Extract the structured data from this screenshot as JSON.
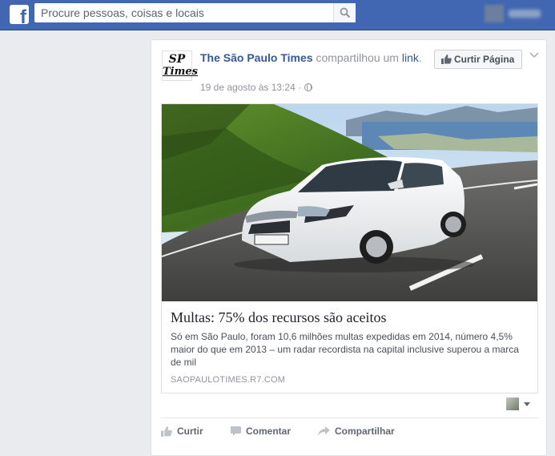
{
  "topbar": {
    "logo_letter": "f",
    "search_placeholder": "Procure pessoas, coisas e locais"
  },
  "post": {
    "page_name": "The São Paulo Times",
    "action_text": " compartilhou um ",
    "link_word": "link",
    "after_link": ".",
    "timestamp": "19 de agosto às 13:24 · ",
    "logo_line1": "SP",
    "logo_line2": "Times",
    "like_page_label": "Curtir Página"
  },
  "preview": {
    "title": "Multas: 75% dos recursos são aceitos",
    "description": "Só em São Paulo, foram 10,6 milhões multas expedidas em 2014, número 4,5% maior do que em 2013 – um radar recordista na capital inclusive superou a marca de mil",
    "domain": "SAOPAULOTIMES.R7.COM"
  },
  "actions": {
    "like": "Curtir",
    "comment": "Comentar",
    "share": "Compartilhar"
  },
  "colors": {
    "brand": "#4267b2",
    "link": "#365899"
  }
}
